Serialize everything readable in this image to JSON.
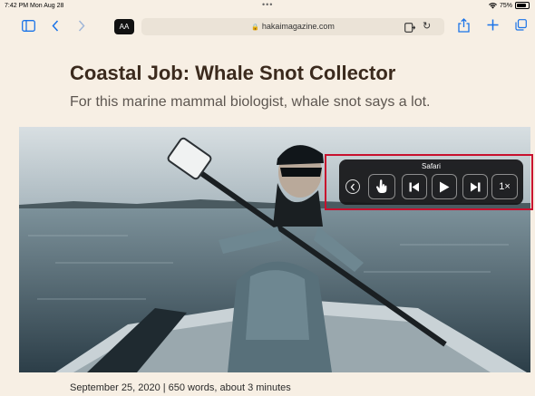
{
  "status_bar": {
    "time": "7:42 PM",
    "date": "Mon Aug 28",
    "wifi_icon": "wifi-icon",
    "battery": "75%"
  },
  "toolbar": {
    "reader_label": "AA",
    "url": "hakaimagazine.com"
  },
  "article": {
    "title": "Coastal Job: Whale Snot Collector",
    "subtitle": "For this marine mammal biologist, whale snot says a lot.",
    "dateline": "September 25, 2020 | 650 words, about 3 minutes"
  },
  "hero_image": {
    "description": "scientist in a boat holding a long pole with a drone attached, on a calm bay"
  },
  "control_panel": {
    "label": "Safari",
    "buttons": [
      {
        "name": "back",
        "icon": "chevron-left-icon"
      },
      {
        "name": "touch",
        "icon": "hand-point-icon"
      },
      {
        "name": "previous",
        "icon": "skip-back-icon"
      },
      {
        "name": "play",
        "icon": "play-icon"
      },
      {
        "name": "next",
        "icon": "skip-forward-icon"
      },
      {
        "name": "speed",
        "label": "1×"
      }
    ]
  },
  "colors": {
    "accent": "#1a73e8",
    "page_bg": "#f7efe4",
    "title": "#3b2a1d",
    "highlight": "#c8102e"
  }
}
